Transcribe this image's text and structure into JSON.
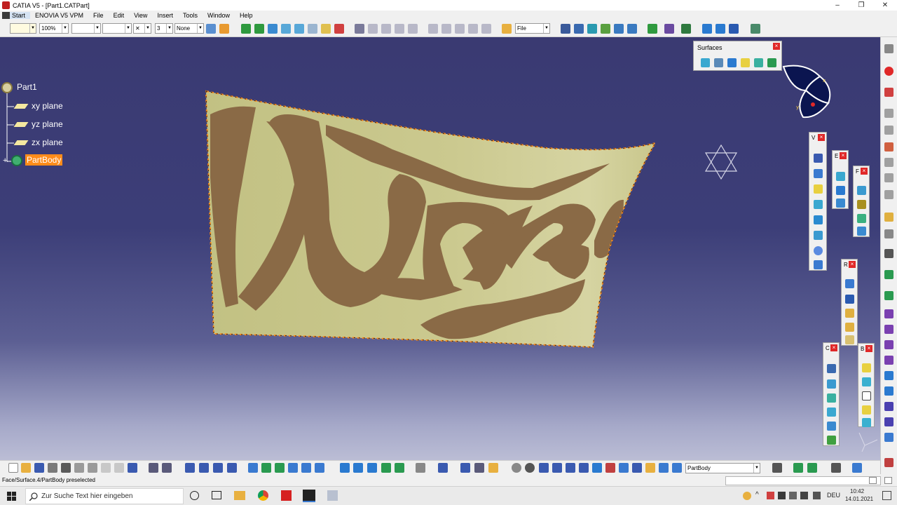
{
  "window": {
    "title": "CATIA V5 - [Part1.CATPart]",
    "minimize": "–",
    "restore": "❐",
    "close": "✕"
  },
  "menu": [
    "Start",
    "ENOVIA V5 VPM",
    "File",
    "Edit",
    "View",
    "Insert",
    "Tools",
    "Window",
    "Help"
  ],
  "toolbar": {
    "zoom": "100%",
    "layer": "None",
    "file_filter": "File",
    "linetype_value": "",
    "thickness_value": "",
    "point_value": "3"
  },
  "tree": {
    "root": "Part1",
    "items": [
      "xy plane",
      "yz plane",
      "zx plane"
    ],
    "body": "PartBody"
  },
  "palettes": {
    "surfaces_title": "Surfaces",
    "wireframe_letter": "V",
    "extrude_letter": "E",
    "fillet_letter": "F",
    "replication_letter": "R",
    "operations_letter": "C",
    "boolean_letter": "B"
  },
  "compass_axes": {
    "x": "x",
    "y": "y"
  },
  "bottom": {
    "current_body": "PartBody"
  },
  "status": {
    "text": "Face/Surface.4/PartBody preselected"
  },
  "taskbar": {
    "search_placeholder": "Zur Suche Text hier eingeben",
    "language": "DEU",
    "time": "10:42",
    "date": "14.01.2021"
  },
  "colors": {
    "viewport_top": "#3a3a72",
    "surface_fill": "#c9c78c",
    "surface_pattern": "#8a6a46",
    "selection": "#ff8c1a",
    "close_red": "#e02828"
  }
}
